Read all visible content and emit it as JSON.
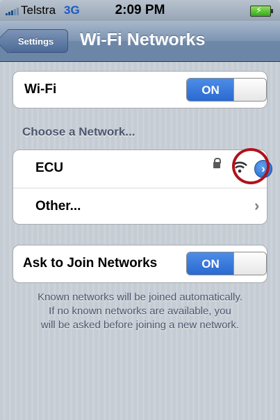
{
  "status_bar": {
    "carrier": "Telstra",
    "network_type": "3G",
    "time": "2:09 PM",
    "battery_state": "charging",
    "colors": {
      "network_type": "#1a5bc4",
      "battery": "#36a81e"
    }
  },
  "nav": {
    "back_label": "Settings",
    "title": "Wi-Fi Networks"
  },
  "wifi": {
    "label": "Wi-Fi",
    "toggle_label": "ON",
    "enabled": true
  },
  "choose_network": {
    "header": "Choose a Network...",
    "networks": [
      {
        "name": "ECU",
        "secured": true,
        "icons": [
          "lock-icon",
          "wifi-signal-icon",
          "detail-disclosure-icon"
        ]
      },
      {
        "name": "Other...",
        "icons": [
          "chevron-right-icon"
        ]
      }
    ]
  },
  "ask_to_join": {
    "label": "Ask to Join Networks",
    "toggle_label": "ON",
    "enabled": true
  },
  "footnote": {
    "lines": [
      "Known networks will be joined automatically.",
      "If no known networks are available, you",
      "will be asked before joining a new network."
    ]
  },
  "colors": {
    "accent_blue": "#2a6ad1",
    "highlight_ring": "#b0121a",
    "background": "#c5ccd4"
  }
}
